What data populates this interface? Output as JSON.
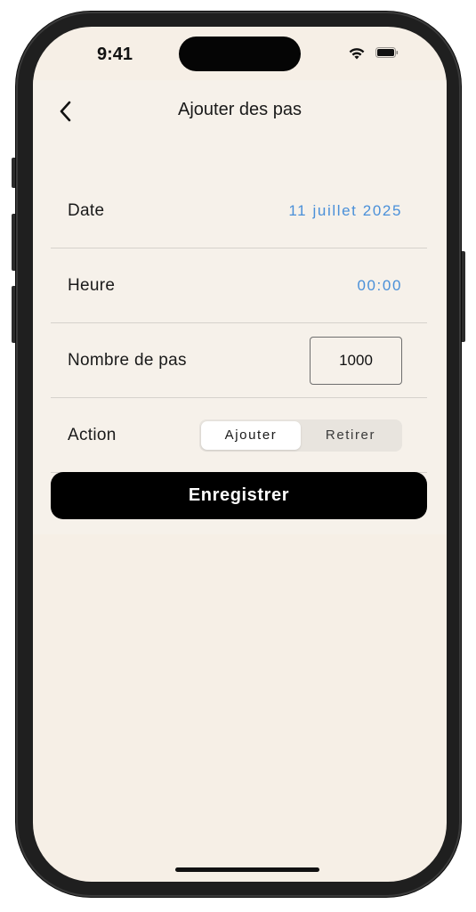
{
  "status_bar": {
    "time": "9:41"
  },
  "header": {
    "title": "Ajouter des pas"
  },
  "form": {
    "date": {
      "label": "Date",
      "value": "11 juillet 2025"
    },
    "time": {
      "label": "Heure",
      "value": "00:00"
    },
    "steps": {
      "label": "Nombre de pas",
      "value": "1000"
    },
    "action": {
      "label": "Action",
      "options": [
        "Ajouter",
        "Retirer"
      ],
      "selected": "Ajouter"
    }
  },
  "save_button": {
    "label": "Enregistrer"
  },
  "colors": {
    "background": "#f6f1ea",
    "accent_link": "#4a90d9",
    "button": "#000000"
  }
}
